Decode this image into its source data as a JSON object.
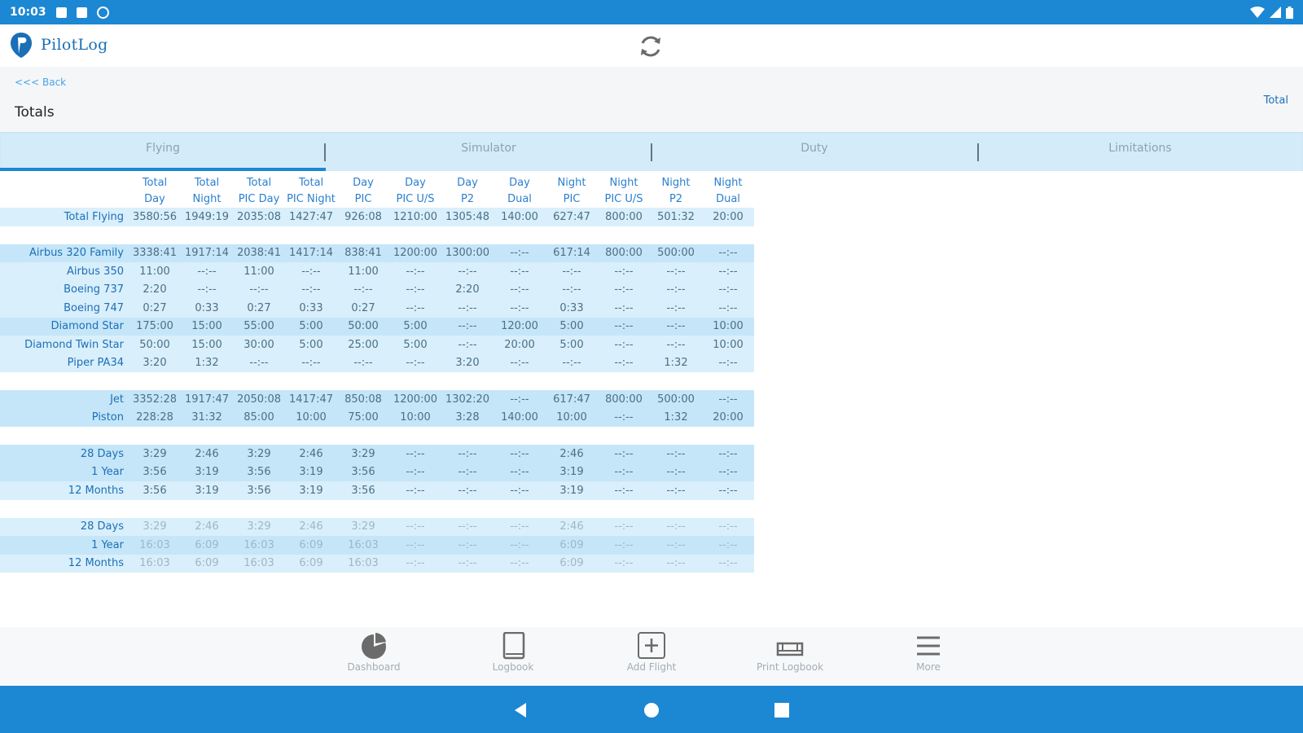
{
  "status_bar": {
    "time": "10:03"
  },
  "app": {
    "name": "PilotLog"
  },
  "subheader": {
    "back_label": "<<< Back",
    "title": "Totals",
    "total_link": "Total"
  },
  "tabs": [
    {
      "label": "Flying",
      "active": true
    },
    {
      "label": "Simulator",
      "active": false
    },
    {
      "label": "Duty",
      "active": false
    },
    {
      "label": "Limitations",
      "active": false
    }
  ],
  "columns": [
    [
      "Total",
      "Day"
    ],
    [
      "Total",
      "Night"
    ],
    [
      "Total",
      "PIC Day"
    ],
    [
      "Total",
      "PIC Night"
    ],
    [
      "Day",
      "PIC"
    ],
    [
      "Day",
      "PIC U/S"
    ],
    [
      "Day",
      "P2"
    ],
    [
      "Day",
      "Dual"
    ],
    [
      "Night",
      "PIC"
    ],
    [
      "Night",
      "PIC U/S"
    ],
    [
      "Night",
      "P2"
    ],
    [
      "Night",
      "Dual"
    ]
  ],
  "rows": [
    {
      "label": "Total Flying",
      "values": [
        "3580:56",
        "1949:19",
        "2035:08",
        "1427:47",
        "926:08",
        "1210:00",
        "1305:48",
        "140:00",
        "627:47",
        "800:00",
        "501:32",
        "20:00"
      ],
      "style": "band"
    },
    {
      "gap": true
    },
    {
      "label": "Airbus 320 Family",
      "values": [
        "3338:41",
        "1917:14",
        "2038:41",
        "1417:14",
        "838:41",
        "1200:00",
        "1300:00",
        "--:--",
        "617:14",
        "800:00",
        "500:00",
        "--:--"
      ],
      "style": "band2"
    },
    {
      "label": "Airbus 350",
      "values": [
        "11:00",
        "--:--",
        "11:00",
        "--:--",
        "11:00",
        "--:--",
        "--:--",
        "--:--",
        "--:--",
        "--:--",
        "--:--",
        "--:--"
      ],
      "style": "band"
    },
    {
      "label": "Boeing 737",
      "values": [
        "2:20",
        "--:--",
        "--:--",
        "--:--",
        "--:--",
        "--:--",
        "2:20",
        "--:--",
        "--:--",
        "--:--",
        "--:--",
        "--:--"
      ],
      "style": "band"
    },
    {
      "label": "Boeing 747",
      "values": [
        "0:27",
        "0:33",
        "0:27",
        "0:33",
        "0:27",
        "--:--",
        "--:--",
        "--:--",
        "0:33",
        "--:--",
        "--:--",
        "--:--"
      ],
      "style": "band"
    },
    {
      "label": "Diamond Star",
      "values": [
        "175:00",
        "15:00",
        "55:00",
        "5:00",
        "50:00",
        "5:00",
        "--:--",
        "120:00",
        "5:00",
        "--:--",
        "--:--",
        "10:00"
      ],
      "style": "band2"
    },
    {
      "label": "Diamond Twin Star",
      "values": [
        "50:00",
        "15:00",
        "30:00",
        "5:00",
        "25:00",
        "5:00",
        "--:--",
        "20:00",
        "5:00",
        "--:--",
        "--:--",
        "10:00"
      ],
      "style": "band"
    },
    {
      "label": "Piper PA34",
      "values": [
        "3:20",
        "1:32",
        "--:--",
        "--:--",
        "--:--",
        "--:--",
        "3:20",
        "--:--",
        "--:--",
        "--:--",
        "1:32",
        "--:--"
      ],
      "style": "band"
    },
    {
      "gap": true
    },
    {
      "label": "Jet",
      "values": [
        "3352:28",
        "1917:47",
        "2050:08",
        "1417:47",
        "850:08",
        "1200:00",
        "1302:20",
        "--:--",
        "617:47",
        "800:00",
        "500:00",
        "--:--"
      ],
      "style": "band2"
    },
    {
      "label": "Piston",
      "values": [
        "228:28",
        "31:32",
        "85:00",
        "10:00",
        "75:00",
        "10:00",
        "3:28",
        "140:00",
        "10:00",
        "--:--",
        "1:32",
        "20:00"
      ],
      "style": "band2"
    },
    {
      "gap": true
    },
    {
      "label": "28 Days",
      "values": [
        "3:29",
        "2:46",
        "3:29",
        "2:46",
        "3:29",
        "--:--",
        "--:--",
        "--:--",
        "2:46",
        "--:--",
        "--:--",
        "--:--"
      ],
      "style": "band2"
    },
    {
      "label": "1 Year",
      "values": [
        "3:56",
        "3:19",
        "3:56",
        "3:19",
        "3:56",
        "--:--",
        "--:--",
        "--:--",
        "3:19",
        "--:--",
        "--:--",
        "--:--"
      ],
      "style": "band2"
    },
    {
      "label": "12 Months",
      "values": [
        "3:56",
        "3:19",
        "3:56",
        "3:19",
        "3:56",
        "--:--",
        "--:--",
        "--:--",
        "3:19",
        "--:--",
        "--:--",
        "--:--"
      ],
      "style": "band"
    },
    {
      "gap": true
    },
    {
      "label": "28 Days",
      "values": [
        "3:29",
        "2:46",
        "3:29",
        "2:46",
        "3:29",
        "--:--",
        "--:--",
        "--:--",
        "2:46",
        "--:--",
        "--:--",
        "--:--"
      ],
      "style": "band",
      "faded": true
    },
    {
      "label": "1 Year",
      "values": [
        "16:03",
        "6:09",
        "16:03",
        "6:09",
        "16:03",
        "--:--",
        "--:--",
        "--:--",
        "6:09",
        "--:--",
        "--:--",
        "--:--"
      ],
      "style": "band2",
      "faded": true
    },
    {
      "label": "12 Months",
      "values": [
        "16:03",
        "6:09",
        "16:03",
        "6:09",
        "16:03",
        "--:--",
        "--:--",
        "--:--",
        "6:09",
        "--:--",
        "--:--",
        "--:--"
      ],
      "style": "band",
      "faded": true
    }
  ],
  "bottom_nav": [
    {
      "label": "Dashboard",
      "icon": "pie-chart-icon"
    },
    {
      "label": "Logbook",
      "icon": "book-icon"
    },
    {
      "label": "Add Flight",
      "icon": "add-box-icon"
    },
    {
      "label": "Print Logbook",
      "icon": "print-icon"
    },
    {
      "label": "More",
      "icon": "menu-icon"
    }
  ],
  "colors": {
    "accent": "#1c87d3",
    "tab_bg": "#d4ecfa",
    "row_band": "#d9effb",
    "row_band_dark": "#c5e6f8"
  }
}
